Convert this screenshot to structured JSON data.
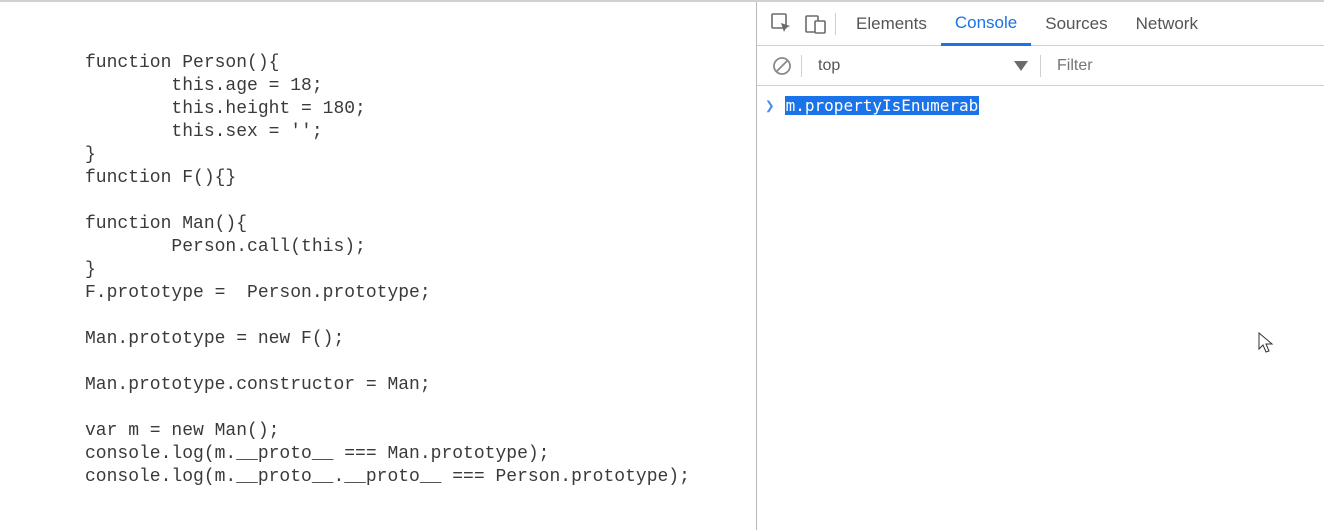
{
  "code": "function Person(){\n        this.age = 18;\n        this.height = 180;\n        this.sex = '';\n}\nfunction F(){}\n\nfunction Man(){\n        Person.call(this);\n}\nF.prototype =  Person.prototype;\n\nMan.prototype = new F();\n\nMan.prototype.constructor = Man;\n\nvar m = new Man();\nconsole.log(m.__proto__ === Man.prototype);\nconsole.log(m.__proto__.__proto__ === Person.prototype);",
  "tabs": {
    "elements": "Elements",
    "console": "Console",
    "sources": "Sources",
    "network": "Network"
  },
  "subbar": {
    "context": "top",
    "filter_placeholder": "Filter"
  },
  "console": {
    "input_text": "m.propertyIsEnumerab"
  }
}
